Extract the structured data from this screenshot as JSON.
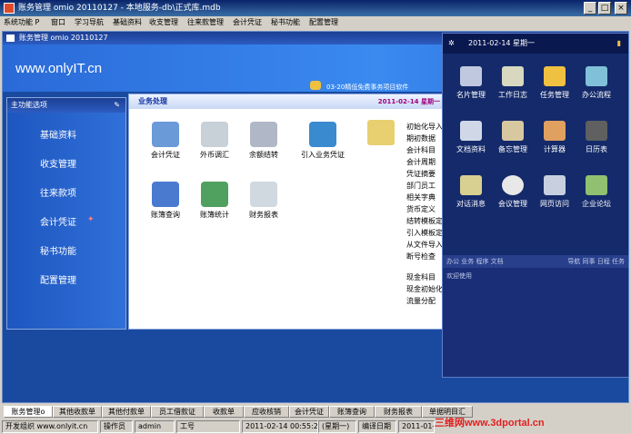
{
  "window": {
    "title": "账务管理 omio 20110127 - 本地服务-db\\正式库.mdb"
  },
  "menu": [
    "系统功能 P",
    "窗口",
    "学习导航",
    "基础资料",
    "收支管理",
    "往来款管理",
    "会计凭证",
    "秘书功能",
    "配置管理"
  ],
  "doc": {
    "title": "账务管理 omio 20110127"
  },
  "banner": {
    "logo": "www.onlyIT.cn",
    "slogan": "03-20精低免费事务项目软件"
  },
  "sidebar": {
    "title": "主功能选项",
    "items": [
      "基础资料",
      "收支管理",
      "往来款项",
      "会计凭证",
      "秘书功能",
      "配置管理"
    ]
  },
  "main": {
    "title": "业务处理",
    "date": "2011-02-14 星期一",
    "icons": [
      "会计凭证",
      "外币调汇",
      "余额结转",
      "引入业务凭证",
      "账簿查询",
      "账簿统计",
      "财务报表"
    ],
    "right_list": [
      "初始化导入",
      "期初数据",
      "会计科目",
      "会计周期",
      "凭证摘要",
      "部门员工",
      "相关字典",
      "货币定义",
      "结转模板定",
      "引入模板定",
      "从文件导入",
      "断号检查",
      "现金科目",
      "现金初始化",
      "流量分配"
    ]
  },
  "float": {
    "date": "2011-02-14 星期一",
    "icons": [
      "名片管理",
      "工作日志",
      "任务管理",
      "办公流程",
      "文档资料",
      "备忘管理",
      "计算器",
      "日历表",
      "对话消息",
      "会议管理",
      "网页访问",
      "企业论坛"
    ],
    "bar_left": "办公 业务 程序 文档",
    "bar_right": "导航 同事 日程 任务",
    "welcome": "欢迎使用"
  },
  "tabs": [
    "账务管理o",
    "其他收款单",
    "其他付款单",
    "员工借款证",
    "收款单",
    "应收核销",
    "会计凭证",
    "账簿查询",
    "财务报表",
    "单据明目汇"
  ],
  "status": [
    "开发组织 www.onlyit.cn",
    "操作员",
    "admin",
    "工号",
    "2011-02-14 00:55:26",
    "(星期一)",
    "编译日期",
    "2011-01-"
  ],
  "watermark": "三维网www.3dportal.cn",
  "colors": {
    "accent": "#1a4aa0",
    "title": "#0a246a"
  }
}
